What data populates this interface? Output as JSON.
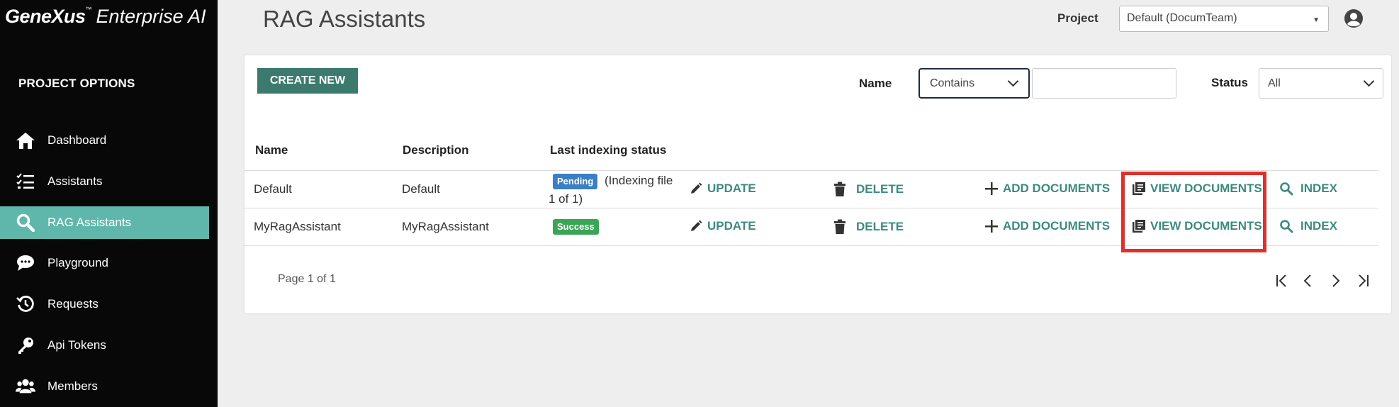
{
  "sidebar": {
    "logo_brand": "GeneXus",
    "logo_tm": "™",
    "logo_product": "Enterprise AI",
    "section_title": "PROJECT OPTIONS",
    "items": [
      {
        "label": "Dashboard",
        "icon": "home-icon"
      },
      {
        "label": "Assistants",
        "icon": "checklist-icon"
      },
      {
        "label": "RAG Assistants",
        "icon": "search-icon",
        "active": true
      },
      {
        "label": "Playground",
        "icon": "chat-icon"
      },
      {
        "label": "Requests",
        "icon": "history-icon"
      },
      {
        "label": "Api Tokens",
        "icon": "key-icon"
      },
      {
        "label": "Members",
        "icon": "users-icon"
      }
    ]
  },
  "header": {
    "title": "RAG Assistants",
    "project_label": "Project",
    "project_value": "Default (DocumTeam)",
    "user_icon": "user-circle-icon"
  },
  "toolbar": {
    "create_new_label": "CREATE NEW",
    "name_filter_label": "Name",
    "name_filter_operator": "Contains",
    "name_filter_value": "",
    "status_filter_label": "Status",
    "status_filter_value": "All"
  },
  "table": {
    "columns": [
      "Name",
      "Description",
      "Last indexing status"
    ],
    "rows": [
      {
        "name": "Default",
        "description": "Default",
        "status_badge": "Pending",
        "status_note_line1": "(Indexing file",
        "status_note_line2": "1 of 1)",
        "actions": [
          "UPDATE",
          "DELETE",
          "ADD DOCUMENTS",
          "VIEW DOCUMENTS",
          "INDEX"
        ]
      },
      {
        "name": "MyRagAssistant",
        "description": "MyRagAssistant",
        "status_badge": "Success",
        "actions": [
          "UPDATE",
          "DELETE",
          "ADD DOCUMENTS",
          "VIEW DOCUMENTS",
          "INDEX"
        ]
      }
    ]
  },
  "pagination": {
    "page_info": "Page 1 of 1"
  },
  "colors": {
    "accent": "#3c8a7e",
    "sidebar_bg": "#080808",
    "sidebar_active": "#5fb7ac",
    "pending": "#3a7fc4",
    "success": "#3aa655",
    "highlight": "#e0302a"
  }
}
